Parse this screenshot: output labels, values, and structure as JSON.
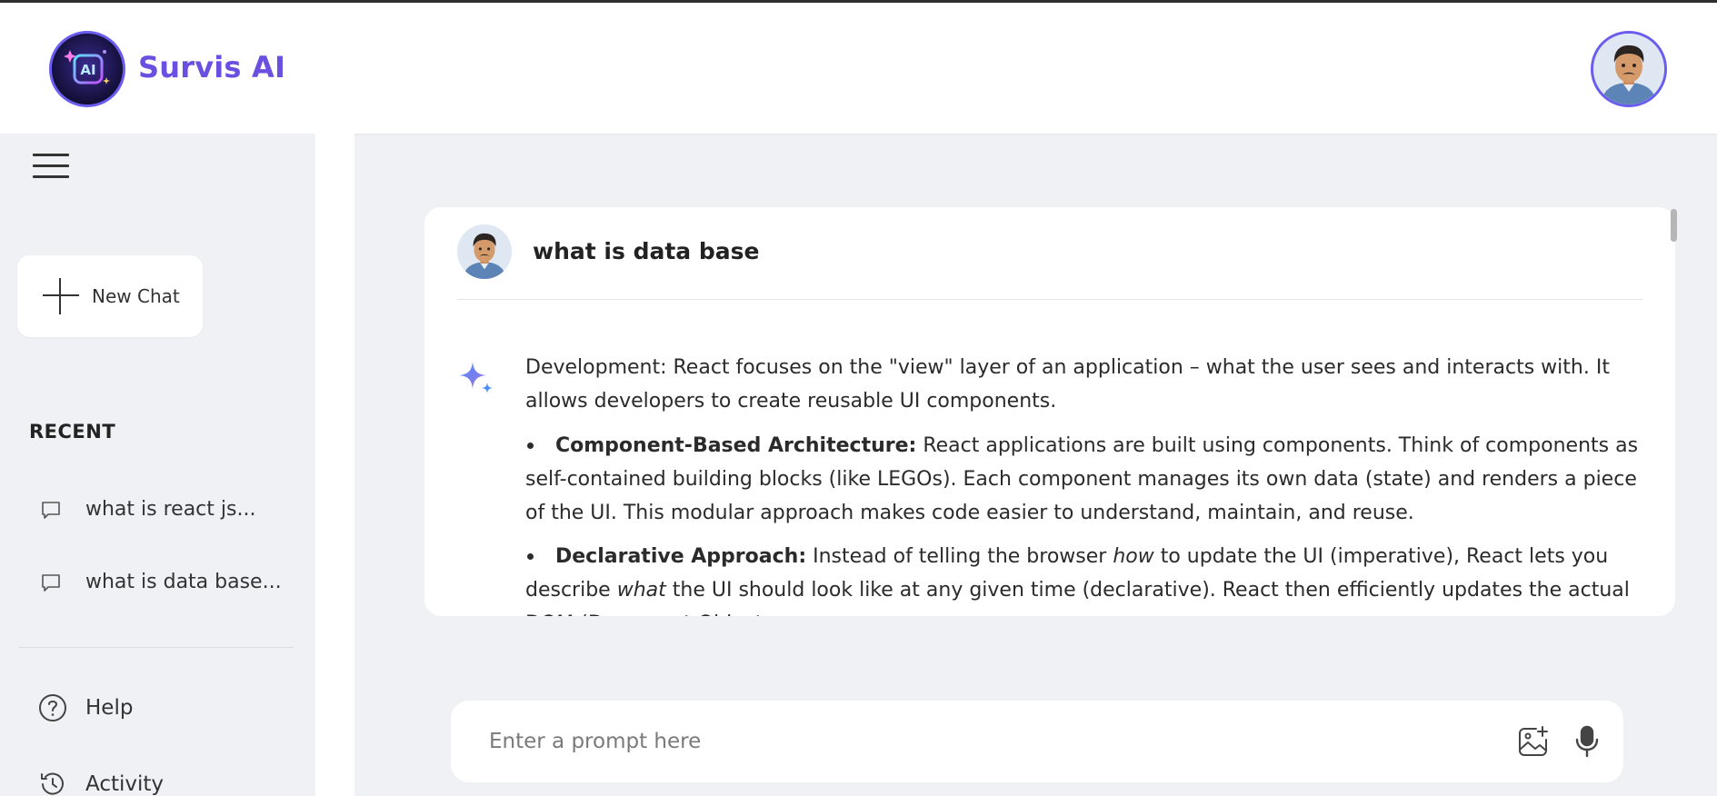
{
  "app": {
    "title": "Survis AI",
    "brand_color": "#6a4fe0",
    "logo_icon": "ai-sparkle-logo",
    "avatar_icon": "user-avatar"
  },
  "sidebar": {
    "menu_icon": "hamburger-icon",
    "new_chat_label": "New Chat",
    "recent_title": "RECENT",
    "recent_items": [
      {
        "label": "what is react js...",
        "icon": "chat-bubble-icon"
      },
      {
        "label": "what is data base...",
        "icon": "chat-bubble-icon"
      }
    ],
    "bottom_items": [
      {
        "label": "Help",
        "icon": "help-circle-icon"
      },
      {
        "label": "Activity",
        "icon": "history-icon"
      }
    ]
  },
  "chat": {
    "question": "what is data base",
    "answer_intro": "Development: React focuses on the \"view\" layer of an application – what the user sees and interacts with. It allows developers to create reusable UI components.",
    "bullets": [
      {
        "lead": "Component-Based Architecture:",
        "text": " React applications are built using components. Think of components as self-contained building blocks (like LEGOs). Each component manages its own data (state) and renders a piece of the UI. This modular approach makes code easier to understand, maintain, and reuse."
      },
      {
        "lead": "Declarative Approach:",
        "text_1": " Instead of telling the browser ",
        "em_1": "how",
        "text_2": " to update the UI (imperative), React lets you describe ",
        "em_2": "what",
        "text_3": " the UI should look like at any given time (declarative). React then efficiently updates the actual DOM (Document Object..."
      }
    ]
  },
  "prompt": {
    "placeholder": "Enter a prompt here",
    "image_icon": "image-upload-icon",
    "mic_icon": "microphone-icon"
  }
}
